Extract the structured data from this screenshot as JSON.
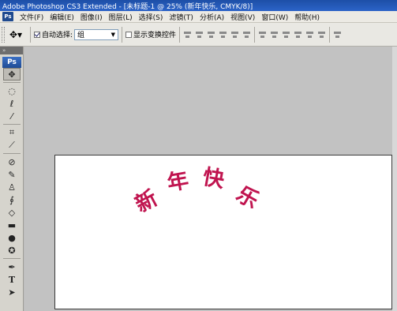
{
  "window": {
    "title": "Adobe Photoshop CS3 Extended - [未标题-1 @ 25% (新年快乐, CMYK/8)]",
    "app_badge": "Ps"
  },
  "menubar": {
    "items": [
      "文件(F)",
      "编辑(E)",
      "图像(I)",
      "图层(L)",
      "选择(S)",
      "滤镜(T)",
      "分析(A)",
      "视图(V)",
      "窗口(W)",
      "帮助(H)"
    ]
  },
  "options": {
    "auto_select_label": "自动选择:",
    "auto_select_checked": true,
    "auto_select_value": "组",
    "show_transform_label": "显示变换控件",
    "show_transform_checked": false
  },
  "tools": {
    "logo": "Ps",
    "dock_label": "»",
    "icons": [
      "move-icon",
      "marquee-icon",
      "lasso-icon",
      "magic-wand-icon",
      "crop-icon",
      "eyedropper-icon",
      "healing-brush-icon",
      "brush-icon",
      "clone-stamp-icon",
      "history-brush-icon",
      "eraser-icon",
      "gradient-icon",
      "blur-icon",
      "dodge-icon",
      "pen-icon",
      "type-icon",
      "path-selection-icon"
    ]
  },
  "document": {
    "characters": [
      "新",
      "年",
      "快",
      "乐"
    ],
    "text_color": "#c0144f"
  }
}
